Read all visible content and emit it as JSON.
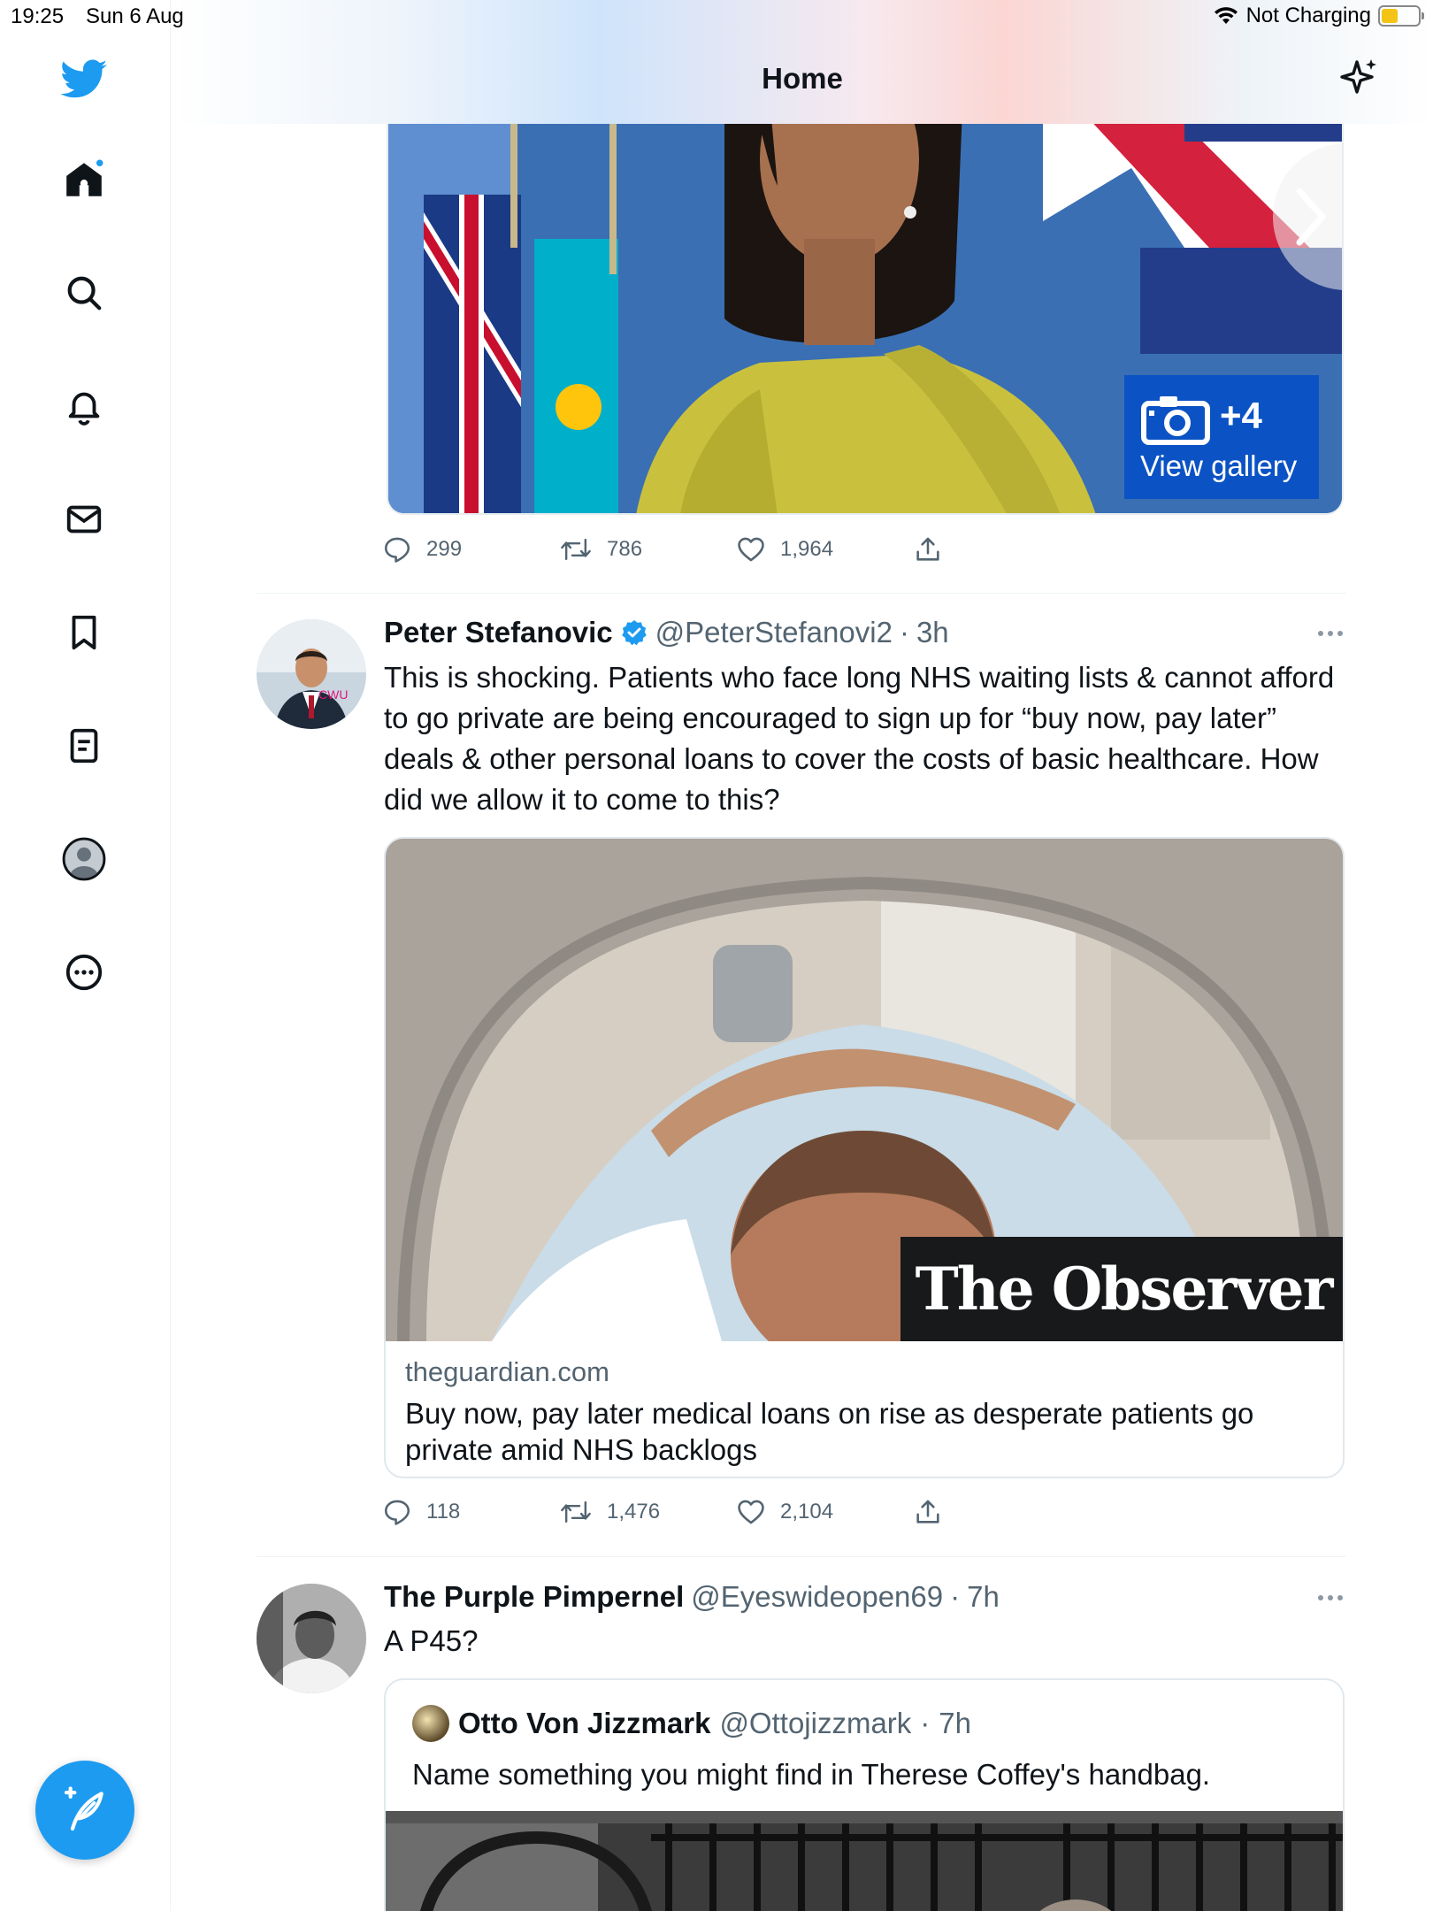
{
  "status_bar": {
    "time": "19:25",
    "date": "Sun 6 Aug",
    "charging": "Not Charging"
  },
  "header": {
    "title": "Home"
  },
  "sidebar": {
    "items": [
      {
        "name": "home"
      },
      {
        "name": "search"
      },
      {
        "name": "notifications"
      },
      {
        "name": "messages"
      },
      {
        "name": "bookmarks"
      },
      {
        "name": "lists"
      },
      {
        "name": "profile"
      },
      {
        "name": "more"
      }
    ]
  },
  "tweet1": {
    "gallery_count": "+4",
    "gallery_label": "View gallery",
    "replies": "299",
    "retweets": "786",
    "likes": "1,964"
  },
  "tweet2": {
    "name": "Peter Stefanovic",
    "handle": "@PeterStefanovi2",
    "separator": "·",
    "time": "3h",
    "avatar_badge": "CWU",
    "text": "This is shocking. Patients who face long NHS waiting lists & cannot afford to go private are being encouraged to sign up for “buy now, pay later” deals & other personal loans to cover the costs of basic healthcare. How did we allow it to come to this?",
    "card": {
      "brand": "The Observer",
      "domain": "theguardian.com",
      "headline": "Buy now, pay later medical loans on rise as desperate patients go private amid NHS backlogs"
    },
    "replies": "118",
    "retweets": "1,476",
    "likes": "2,104"
  },
  "tweet3": {
    "name": "The Purple Pimpernel",
    "handle": "@Eyeswideopen69",
    "separator": "·",
    "time": "7h",
    "text": "A P45?",
    "quote": {
      "name": "Otto Von Jizzmark",
      "handle": "@Ottojizzmark",
      "separator": "·",
      "time": "7h",
      "text": "Name something you might find in Therese Coffey's handbag."
    }
  },
  "colors": {
    "accent": "#1d9bf0",
    "text_primary": "#0f1419",
    "text_secondary": "#536471",
    "gallery_badge": "#0b53c4"
  }
}
